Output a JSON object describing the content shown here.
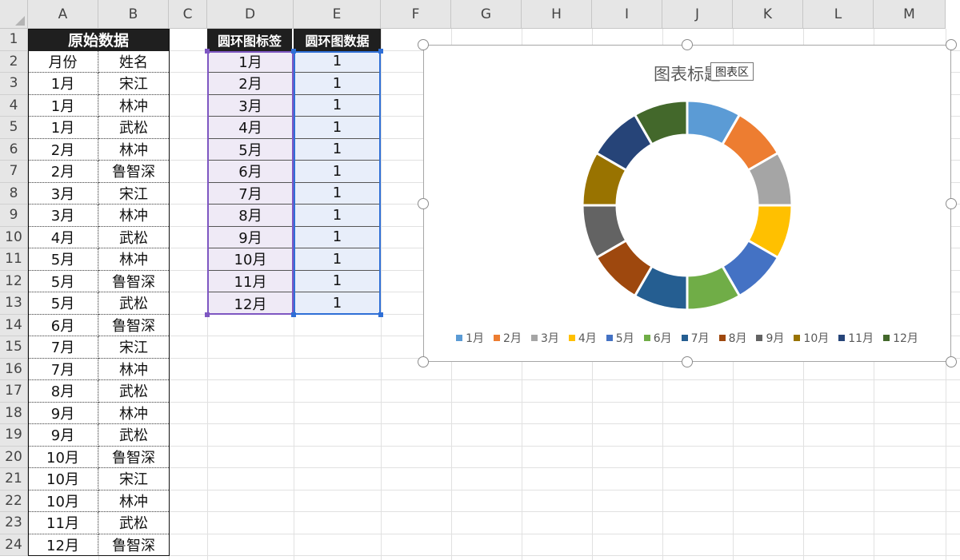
{
  "columns": [
    "A",
    "B",
    "C",
    "D",
    "E",
    "F",
    "G",
    "H",
    "I",
    "J",
    "K",
    "L",
    "M"
  ],
  "rows": [
    "1",
    "2",
    "3",
    "4",
    "5",
    "6",
    "7",
    "8",
    "9",
    "10",
    "11",
    "12",
    "13",
    "14",
    "15",
    "16",
    "17",
    "18",
    "19",
    "20",
    "21",
    "22",
    "23",
    "24"
  ],
  "source": {
    "title": "原始数据",
    "headers": [
      "月份",
      "姓名"
    ],
    "records": [
      [
        "1月",
        "宋江"
      ],
      [
        "1月",
        "林冲"
      ],
      [
        "1月",
        "武松"
      ],
      [
        "2月",
        "林冲"
      ],
      [
        "2月",
        "鲁智深"
      ],
      [
        "3月",
        "宋江"
      ],
      [
        "3月",
        "林冲"
      ],
      [
        "4月",
        "武松"
      ],
      [
        "5月",
        "林冲"
      ],
      [
        "5月",
        "鲁智深"
      ],
      [
        "5月",
        "武松"
      ],
      [
        "6月",
        "鲁智深"
      ],
      [
        "7月",
        "宋江"
      ],
      [
        "7月",
        "林冲"
      ],
      [
        "8月",
        "武松"
      ],
      [
        "9月",
        "林冲"
      ],
      [
        "9月",
        "武松"
      ],
      [
        "10月",
        "鲁智深"
      ],
      [
        "10月",
        "宋江"
      ],
      [
        "10月",
        "林冲"
      ],
      [
        "11月",
        "武松"
      ],
      [
        "12月",
        "鲁智深"
      ]
    ]
  },
  "donut_table": {
    "headers": [
      "圆环图标签",
      "圆环图数据"
    ],
    "records": [
      [
        "1月",
        "1"
      ],
      [
        "2月",
        "1"
      ],
      [
        "3月",
        "1"
      ],
      [
        "4月",
        "1"
      ],
      [
        "5月",
        "1"
      ],
      [
        "6月",
        "1"
      ],
      [
        "7月",
        "1"
      ],
      [
        "8月",
        "1"
      ],
      [
        "9月",
        "1"
      ],
      [
        "10月",
        "1"
      ],
      [
        "11月",
        "1"
      ],
      [
        "12月",
        "1"
      ]
    ]
  },
  "tooltip": "图表区",
  "chart_data": {
    "type": "pie",
    "variant": "donut",
    "title": "图表标题",
    "categories": [
      "1月",
      "2月",
      "3月",
      "4月",
      "5月",
      "6月",
      "7月",
      "8月",
      "9月",
      "10月",
      "11月",
      "12月"
    ],
    "values": [
      1,
      1,
      1,
      1,
      1,
      1,
      1,
      1,
      1,
      1,
      1,
      1
    ],
    "colors": [
      "#5b9bd5",
      "#ed7d31",
      "#a5a5a5",
      "#ffc000",
      "#4472c4",
      "#70ad47",
      "#255e91",
      "#9e480e",
      "#636363",
      "#997300",
      "#264478",
      "#43682b"
    ],
    "legend_position": "bottom"
  }
}
